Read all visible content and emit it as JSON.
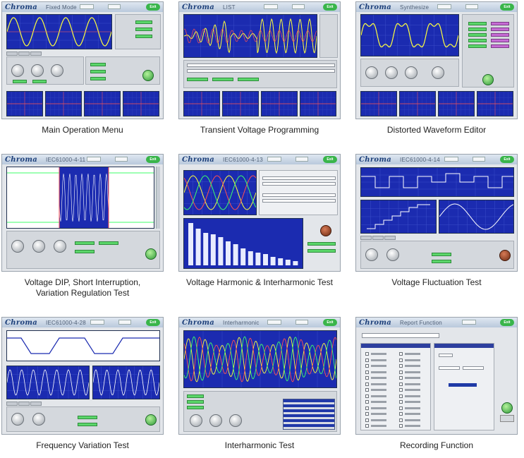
{
  "brand": "Chroma",
  "exit_label": "Exit",
  "tiles": [
    {
      "id": "main-operation",
      "subtitle": "Fixed Mode",
      "caption": "Main Operation Menu"
    },
    {
      "id": "transient-voltage",
      "subtitle": "LIST",
      "caption": "Transient Voltage Programming"
    },
    {
      "id": "distorted-waveform",
      "subtitle": "Synthesize",
      "caption": "Distorted Waveform Editor"
    },
    {
      "id": "voltage-dip",
      "subtitle": "IEC61000-4-11",
      "caption_line1": "Voltage DIP, Short Interruption,",
      "caption_line2": "Variation Regulation Test"
    },
    {
      "id": "voltage-harmonic",
      "subtitle": "IEC61000-4-13",
      "caption": "Voltage Harmonic & Interharmonic Test"
    },
    {
      "id": "voltage-fluctuation",
      "subtitle": "IEC61000-4-14",
      "caption": "Voltage Fluctuation Test"
    },
    {
      "id": "frequency-variation",
      "subtitle": "IEC61000-4-28",
      "caption": "Frequency Variation Test"
    },
    {
      "id": "interharmonic",
      "subtitle": "Interharmonic",
      "caption": "Interharmonic Test"
    },
    {
      "id": "recording",
      "subtitle": "Report Function",
      "caption": "Recording Function"
    }
  ],
  "colors": {
    "plot_bg": "#1b2bb0",
    "trace_yellow": "#ffff3c",
    "trace_red": "#ff5050",
    "trace_green": "#3cff6a",
    "trace_white": "#ffffff",
    "bar": "#e8ecff",
    "exit_green": "#39b54a"
  }
}
